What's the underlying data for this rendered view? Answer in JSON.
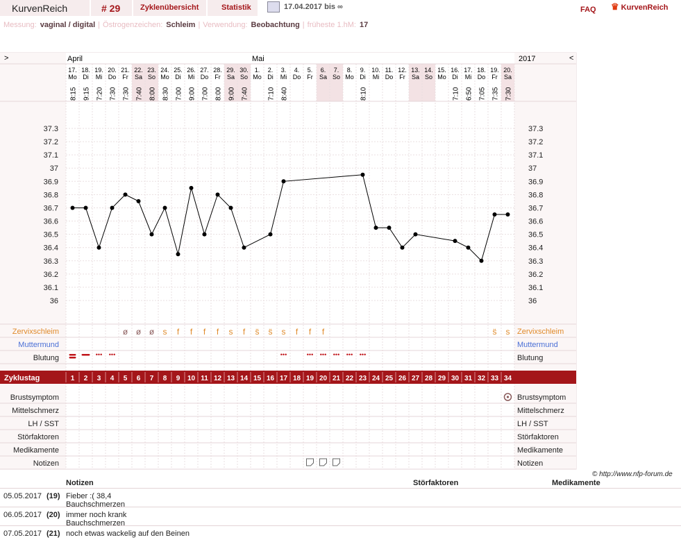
{
  "header": {
    "brand": "KurvenReich",
    "cycle": "# 29",
    "tabs": [
      "Zyklenübersicht",
      "Statistik"
    ],
    "date_range": "17.04.2017 bis ∞",
    "faq": "FAQ",
    "logo_text": "KurvenReich",
    "icons": [
      "print-icon",
      "logo-icon"
    ]
  },
  "info": [
    {
      "label": "Messung:",
      "value": "vaginal / digital"
    },
    {
      "label": "Östrogenzeichen:",
      "value": "Schleim"
    },
    {
      "label": "Verwendung:",
      "value": "Beobachtung"
    },
    {
      "label": "früheste 1.hM:",
      "value": "17"
    }
  ],
  "nav": {
    "prev": ">",
    "next": "<",
    "year": "2017",
    "months": [
      {
        "name": "April",
        "col": 0
      },
      {
        "name": "Mai",
        "col": 14
      }
    ]
  },
  "days": [
    {
      "d": "17.",
      "w": "Mo",
      "time": "8:15",
      "temp": 36.7
    },
    {
      "d": "18.",
      "w": "Di",
      "time": "9:15",
      "temp": 36.7
    },
    {
      "d": "19.",
      "w": "Mi",
      "time": "7:20",
      "temp": 36.4
    },
    {
      "d": "20.",
      "w": "Do",
      "time": "7:30",
      "temp": 36.7
    },
    {
      "d": "21.",
      "w": "Fr",
      "time": "7:30",
      "temp": 36.8
    },
    {
      "d": "22.",
      "w": "Sa",
      "time": "7:40",
      "temp": 36.75,
      "we": true
    },
    {
      "d": "23.",
      "w": "So",
      "time": "8:00",
      "temp": 36.5,
      "we": true
    },
    {
      "d": "24.",
      "w": "Mo",
      "time": "8:30",
      "temp": 36.7
    },
    {
      "d": "25.",
      "w": "Di",
      "time": "7:00",
      "temp": 36.35
    },
    {
      "d": "26.",
      "w": "Mi",
      "time": "9:00",
      "temp": 36.85
    },
    {
      "d": "27.",
      "w": "Do",
      "time": "7:00",
      "temp": 36.5
    },
    {
      "d": "28.",
      "w": "Fr",
      "time": "8:00",
      "temp": 36.8
    },
    {
      "d": "29.",
      "w": "Sa",
      "time": "9:00",
      "temp": 36.7,
      "we": true
    },
    {
      "d": "30.",
      "w": "So",
      "time": "7:40",
      "temp": 36.4,
      "we": true
    },
    {
      "d": "1.",
      "w": "Mo",
      "time": "",
      "temp": null
    },
    {
      "d": "2.",
      "w": "Di",
      "time": "7:10",
      "temp": 36.5
    },
    {
      "d": "3.",
      "w": "Mi",
      "time": "8:40",
      "temp": 36.9
    },
    {
      "d": "4.",
      "w": "Do",
      "time": "",
      "temp": null
    },
    {
      "d": "5.",
      "w": "Fr",
      "time": "",
      "temp": null
    },
    {
      "d": "6.",
      "w": "Sa",
      "time": "",
      "temp": null,
      "we": true
    },
    {
      "d": "7.",
      "w": "So",
      "time": "",
      "temp": null,
      "we": true
    },
    {
      "d": "8.",
      "w": "Mo",
      "time": "",
      "temp": null
    },
    {
      "d": "9.",
      "w": "Di",
      "time": "8:10",
      "temp": 36.95
    },
    {
      "d": "10.",
      "w": "Mi",
      "time": "",
      "temp": 36.55
    },
    {
      "d": "11.",
      "w": "Do",
      "time": "",
      "temp": 36.55
    },
    {
      "d": "12.",
      "w": "Fr",
      "time": "",
      "temp": 36.4
    },
    {
      "d": "13.",
      "w": "Sa",
      "time": "",
      "temp": 36.5,
      "we": true
    },
    {
      "d": "14.",
      "w": "So",
      "time": "",
      "temp": null,
      "we": true
    },
    {
      "d": "15.",
      "w": "Mo",
      "time": "",
      "temp": null
    },
    {
      "d": "16.",
      "w": "Di",
      "time": "7:10",
      "temp": 36.45
    },
    {
      "d": "17.",
      "w": "Mi",
      "time": "6:50",
      "temp": 36.4
    },
    {
      "d": "18.",
      "w": "Do",
      "time": "7:05",
      "temp": 36.3
    },
    {
      "d": "19.",
      "w": "Fr",
      "time": "7:35",
      "temp": 36.65
    },
    {
      "d": "20.",
      "w": "Sa",
      "time": "7:30",
      "temp": 36.65,
      "we": true
    }
  ],
  "chart_data": {
    "type": "line",
    "ylim": [
      36.0,
      37.3
    ],
    "yticks": [
      "37.3",
      "37.2",
      "37.1",
      "37",
      "36.9",
      "36.8",
      "36.7",
      "36.6",
      "36.5",
      "36.4",
      "36.3",
      "36.2",
      "36.1",
      "36"
    ],
    "series": [
      {
        "values": [
          36.7,
          36.7,
          36.4,
          36.7,
          36.8,
          36.75,
          36.5,
          36.7,
          36.35,
          36.85,
          36.5,
          36.8,
          36.7,
          36.4,
          null,
          36.5,
          36.9,
          null,
          null,
          null,
          null,
          null,
          36.95,
          36.55,
          36.55,
          36.4,
          36.5,
          null,
          null,
          36.45,
          36.4,
          36.3,
          36.65,
          36.65
        ]
      }
    ]
  },
  "rows": {
    "zervix": "Zervixschleim",
    "muttermund": "Muttermund",
    "blutung": "Blutung",
    "zyklustag": "Zyklustag",
    "bottom": [
      "Brustsymptom",
      "Mittelschmerz",
      "LH / SST",
      "Störfaktoren",
      "Medikamente",
      "Notizen"
    ]
  },
  "zervix_marks": [
    "",
    "",
    "",
    "",
    "ø",
    "ø",
    "ø",
    "s",
    "f",
    "f",
    "f",
    "f",
    "s",
    "f",
    "s̈",
    "s̈",
    "s",
    "f",
    "f",
    "f",
    "",
    "",
    "",
    "",
    "",
    "",
    "",
    "",
    "",
    "",
    "",
    "",
    "s̈",
    "s"
  ],
  "blutung_marks": [
    "heavy",
    "medium",
    "light",
    "light",
    "",
    "",
    "",
    "",
    "",
    "",
    "",
    "",
    "",
    "",
    "",
    "",
    "light",
    "",
    "light",
    "light",
    "light",
    "light",
    "light",
    "",
    "",
    "",
    "",
    "",
    "",
    "",
    "",
    "",
    "",
    ""
  ],
  "notes_icon_cols": [
    18,
    19,
    20
  ],
  "brust_col": 33,
  "copyright": "© http://www.nfp-forum.de",
  "notes": {
    "headers": [
      "Notizen",
      "Störfaktoren",
      "Medikamente"
    ],
    "rows": [
      {
        "date": "05.05.2017",
        "day": "(19)",
        "text": [
          "Fieber :( 38,4",
          "Bauchschmerzen"
        ]
      },
      {
        "date": "06.05.2017",
        "day": "(20)",
        "text": [
          "immer noch krank",
          "Bauchschmerzen"
        ]
      },
      {
        "date": "07.05.2017",
        "day": "(21)",
        "text": [
          "noch etwas wackelig auf den Beinen"
        ]
      }
    ]
  },
  "colors": {
    "accent": "#a4161a",
    "zervix": "#e08a2a",
    "muttermund": "#4a6fd6",
    "blood": "#c0141a",
    "weekend": "#f3e2e4",
    "grid": "#f9f2f2"
  }
}
